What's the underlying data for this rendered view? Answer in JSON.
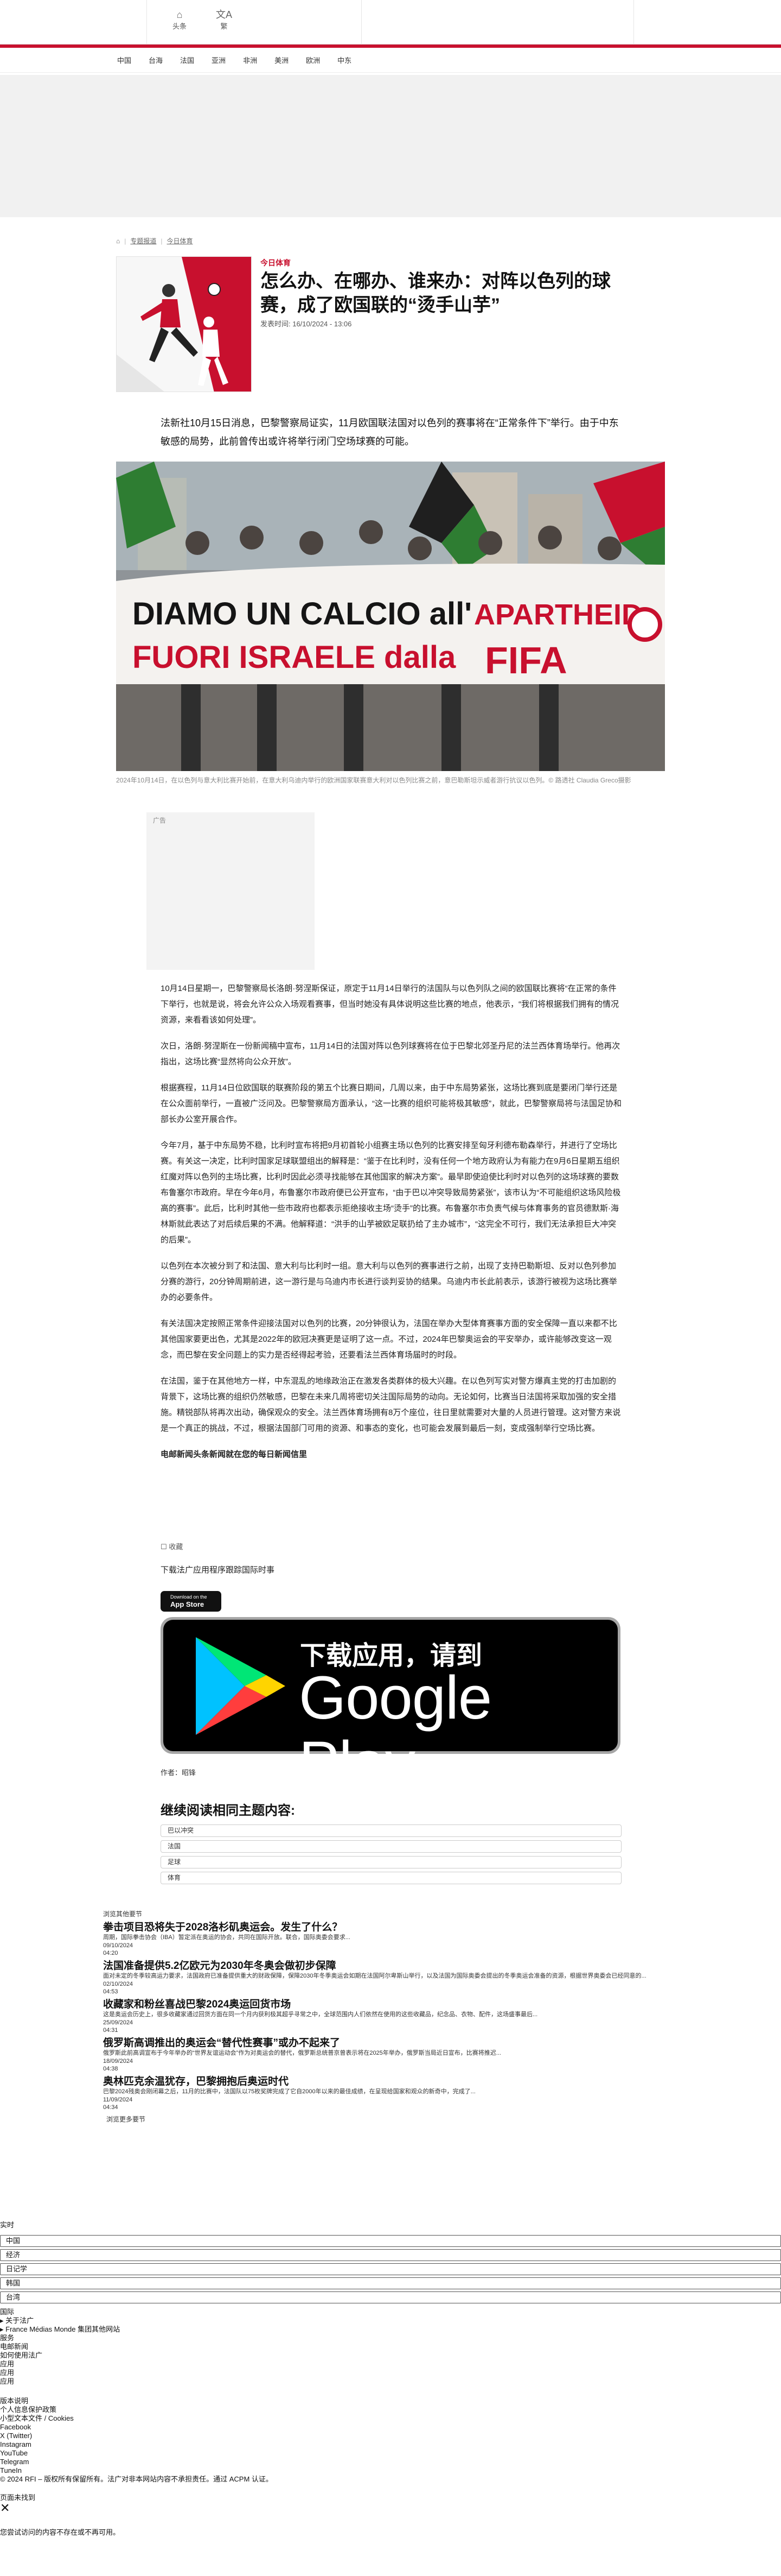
{
  "header": {
    "icons": [
      {
        "icon": "home-icon",
        "label": "头条"
      },
      {
        "icon": "translate-icon",
        "label": "繁"
      }
    ]
  },
  "nav": [
    "中国",
    "台海",
    "法国",
    "亚洲",
    "非洲",
    "美洲",
    "欧洲",
    "中东"
  ],
  "breadcrumb": {
    "home_icon": "home-icon",
    "items": [
      "专题报道",
      "今日体育"
    ]
  },
  "article": {
    "eyebrow": "今日体育",
    "title": "怎么办、在哪办、谁来办：对阵以色列的球赛，成了欧国联的“烫手山芋”",
    "published": "发表时间: 16/10/2024 - 13:06",
    "lead": "法新社10月15日消息，巴黎警察局证实，11月欧国联法国对以色列的赛事将在“正常条件下”举行。由于中东敏感的局势，此前曾传出或许将举行闭门空场球赛的可能。",
    "photo": {
      "banner_line1": "DIAMO UN CALCIO all'",
      "banner_line2": "FUORI ISRAELE dalla",
      "banner_right1": "APARTHEID",
      "banner_right2": "FIFA"
    },
    "caption": "2024年10月14日，在以色列与意大利比赛开始前，在意大利乌迪内举行的欧洲国家联赛意大利对以色列比赛之前，意巴勒斯坦示威者游行抗议以色列。© 路透社 Claudia Greco摄影",
    "ad_label": "广告",
    "paragraphs": [
      "10月14日星期一，巴黎警察局长洛朗·努涅斯保证，原定于11月14日举行的法国队与以色列队之间的欧国联比赛将“在正常的条件下举行，也就是说，将会允许公众入场观看赛事，但当时她没有具体说明这些比赛的地点，他表示，“我们将根据我们拥有的情况资源，来看看该如何处理”。",
      "次日，洛朗·努涅斯在一份新闻稿中宣布，11月14日的法国对阵以色列球赛将在位于巴黎北郊圣丹尼的法兰西体育场举行。他再次指出，这场比赛“显然将向公众开放”。",
      "根据赛程，11月14日位欧国联的联赛阶段的第五个比赛日期间，几周以来，由于中东局势紧张，这场比赛到底是要闭门举行还是在公众面前举行，一直被广泛问及。巴黎警察局方面承认，“这一比赛的组织可能将极其敏感”，就此，巴黎警察局将与法国足协和部长办公室开展合作。",
      "今年7月，基于中东局势不稳，比利时宣布将把9月初首轮小组赛主场以色列的比赛安排至匈牙利德布勒森举行，并进行了空场比赛。有关这一决定，比利时国家足球联盟组出的解释是：“鉴于在比利时，没有任何一个地方政府认为有能力在9月6日星期五组织红魔对阵以色列的主场比赛，比利时因此必须寻找能够在其他国家的解决方案”。最早即使迫使比利时对以色列的这场球赛的要数布鲁塞尔市政府。早在今年6月，布鲁塞尔市政府便已公开宣布，“由于巴以冲突导致局势紧张”，该市认为“不可能组织这场风险极高的赛事”。此后，比利时其他一些市政府也都表示拒绝接收主场“烫手”的比赛。布鲁塞尔市负责气候与体育事务的官员德默斯·海林斯就此表达了对后续后果的不满。他解释道：“洪手的山芋被欧足联扔给了主办城市”，“这完全不可行，我们无法承担巨大冲突的后果”。",
      "以色列在本次被分到了和法国、意大利与比利时一组。意大利与以色列的赛事进行之前，出现了支持巴勒斯坦、反对以色列参加分赛的游行，20分钟周期前进，这一游行是与乌迪内市长进行谈判妥协的结果。乌迪内市长此前表示，该游行被视为这场比赛举办的必要条件。",
      "有关法国决定按照正常条件迎接法国对以色列的比赛，20分钟很认为，法国在举办大型体育赛事方面的安全保障一直以来都不比其他国家要更出色，尤其是2022年的欧冠决赛更是证明了这一点。不过，2024年巴黎奥运会的平安举办，或许能够改变这一观念，而巴黎在安全问题上的实力是否经得起考验，还要看法兰西体育场届时的时段。",
      "在法国，鉴于在其他地方一样，中东混乱的地缘政治正在激发各类群体的极大兴趣。在以色列写实对警方爆真主党的打击加剧的背景下，这场比赛的组织仍然敏感，巴黎在未来几周将密切关注国际局势的动向。无论如何，比赛当日法国将采取加强的安全措施。精锐部队将再次出动，确保观众的安全。法兰西体育场拥有8万个座位，往日里就需要对大量的人员进行管理。这对警方来说是一个真正的挑战，不过，根据法国部门可用的资源、和事态的变化，也可能会发展到最后一刻，变成强制举行空场比赛。",
      "电邮新闻头条新闻就在您的每日新闻信里"
    ],
    "email_bold": "电邮新闻",
    "fav": "☐ 收藏",
    "app_download_text": "下载法广应用程序跟踪国际时事",
    "appstore": {
      "top": "Download on the",
      "bottom": "App Store"
    },
    "gplay": {
      "top": "下载应用，请到",
      "main": "Google Play"
    },
    "author": "作者：昭锋",
    "related_heading": "继续阅读相同主题内容:",
    "tags": [
      "巴以冲突",
      "法国",
      "足球",
      "体育"
    ]
  },
  "dont_miss": {
    "label": "浏览其他要节",
    "more": "浏览更多要节",
    "items": [
      {
        "title": "拳击项目恐将失于2028洛杉矶奥运会。发生了什么？",
        "desc": "周期，国际拳击协会（IBA）暂定派在奥运的协会，共同在国际开放。联合，国际奥委会要求...",
        "date": "09/10/2024",
        "time": "04:20"
      },
      {
        "title": "法国准备提供5.2亿欧元为2030年冬奥会做初步保障",
        "desc": "面对未定的冬季较高运力要求，法国政府已准备提供重大的财政保障，保障2030年冬季奥运会如期在法国阿尔卑斯山举行，以及法国为国际奥委会提出的冬季奥运会准备的资源，根据世界奥委会已经同意的...",
        "date": "02/10/2024",
        "time": "04:53"
      },
      {
        "title": "收藏家和粉丝喜战巴黎2024奥运回货市场",
        "desc": "这是奥运会历史上，很多收藏家通过回货方面在同一个月内获利极其超乎寻常之中，全球范围内人们依然在使用的这些收藏品，纪念品、衣物、配件，这场盛事最后...",
        "date": "25/09/2024",
        "time": "04:31"
      },
      {
        "title": "俄罗斯高调推出的奥运会“替代性赛事”或办不起来了",
        "desc": "俄罗斯此前高调宣布于今年举办的“世界友谊运动会”作为对奥运会的替代，俄罗斯总统普京曾表示将在2025年举办，俄罗斯当局近日宣布，比赛将推迟...",
        "date": "18/09/2024",
        "time": "04:38"
      },
      {
        "title": "奥林匹克余温犹存，巴黎拥抱后奥运时代",
        "desc": "巴黎2024残奥会刚闭幕之后，11月的比赛中，法国队以75枚奖牌完成了它自2000年以来的最佳成绩，在呈现给国家和观众的新奇中，完成了...",
        "date": "11/09/2024",
        "time": "04:34"
      }
    ]
  },
  "footer": {
    "realtime": "实时",
    "languages": [
      "中国",
      "经济",
      "日记学",
      "韩国",
      "台湾"
    ],
    "lines1": [
      "国际",
      "▸ 关于法广",
      "▸ France Médias Monde 集团其他网站",
      "服务",
      "电邮新闻",
      "如何使用法广",
      "应用",
      "应用",
      "应用"
    ],
    "lines2": [
      "版本说明",
      "个人信息保护政策",
      "小型文本文件 / Cookies",
      "Facebook",
      "X (Twitter)",
      "Instagram",
      "YouTube",
      "Telegram",
      "TuneIn",
      "© 2024 RFI – 版权所有保留所有。法广对非本网站内容不承担责任。通过 ACPM 认证。"
    ],
    "error_title": "页面未找到",
    "error_text": "您尝试访问的内容不存在或不再可用。"
  }
}
